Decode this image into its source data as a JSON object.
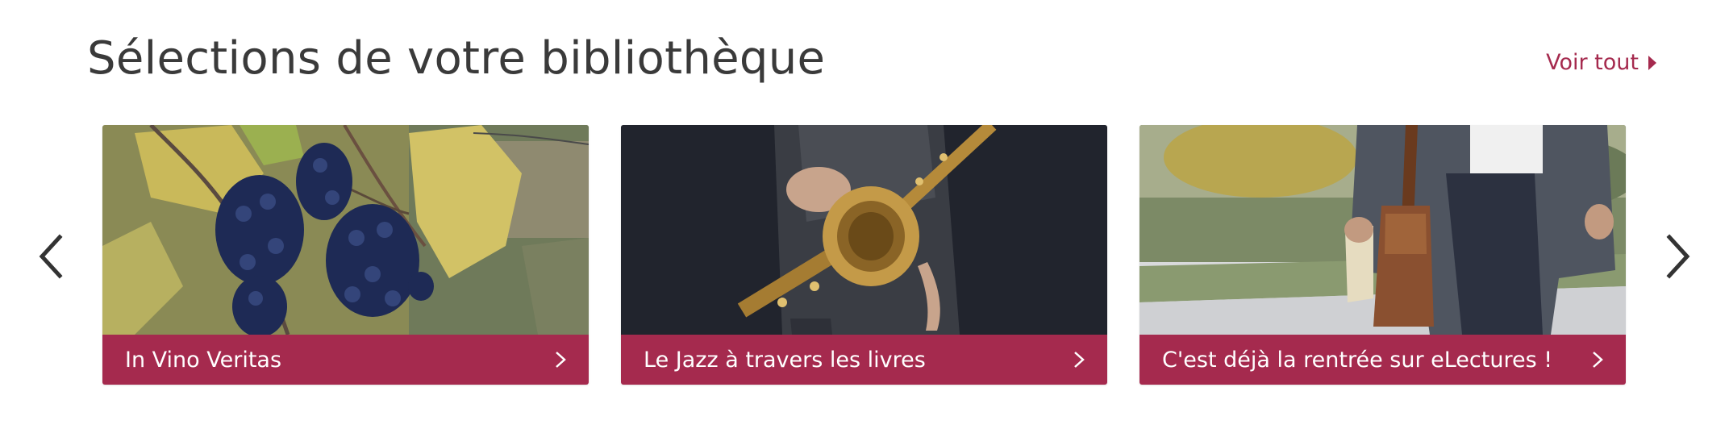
{
  "section": {
    "title": "Sélections de votre bibliothèque",
    "see_all_label": "Voir tout"
  },
  "colors": {
    "accent": "#a52a4e",
    "title_text": "#3a3a3a",
    "arrow": "#333333"
  },
  "icons": {
    "see_all": "caret-right-icon",
    "prev": "chevron-left-icon",
    "next": "chevron-right-icon",
    "card": "chevron-right-icon"
  },
  "cards": [
    {
      "label": "In Vino Veritas",
      "image": "grapes-vineyard-photo"
    },
    {
      "label": "Le Jazz à travers les livres",
      "image": "saxophone-player-photo"
    },
    {
      "label": "C'est déjà la rentrée sur eLectures !",
      "image": "man-with-book-and-bag-photo"
    }
  ]
}
